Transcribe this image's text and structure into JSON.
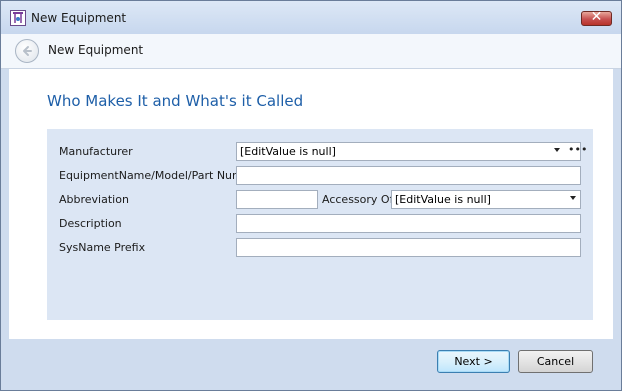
{
  "window": {
    "title": "New Equipment"
  },
  "wizard": {
    "header_title": "New Equipment",
    "page_heading": "Who Makes It and What's it Called"
  },
  "form": {
    "manufacturer": {
      "label": "Manufacturer",
      "value": "[EditValue is null]"
    },
    "equipment_name": {
      "label": "EquipmentName/Model/Part Number",
      "value": ""
    },
    "abbreviation": {
      "label": "Abbreviation",
      "value": ""
    },
    "accessory_of": {
      "label": "Accessory Of",
      "value": "[EditValue is null]"
    },
    "description": {
      "label": "Description",
      "value": ""
    },
    "sysname_prefix": {
      "label": "SysName Prefix",
      "value": ""
    }
  },
  "footer": {
    "next_label": "Next >",
    "cancel_label": "Cancel"
  },
  "icons": {
    "app": "app-icon",
    "close": "close-icon",
    "back": "back-arrow-icon",
    "dropdown": "chevron-down-icon",
    "ellipsis": "ellipsis-icon"
  },
  "colors": {
    "heading": "#1e5fa8",
    "window_frame": "#cfdcee",
    "form_panel": "#dce6f4",
    "close_button": "#c75050"
  }
}
